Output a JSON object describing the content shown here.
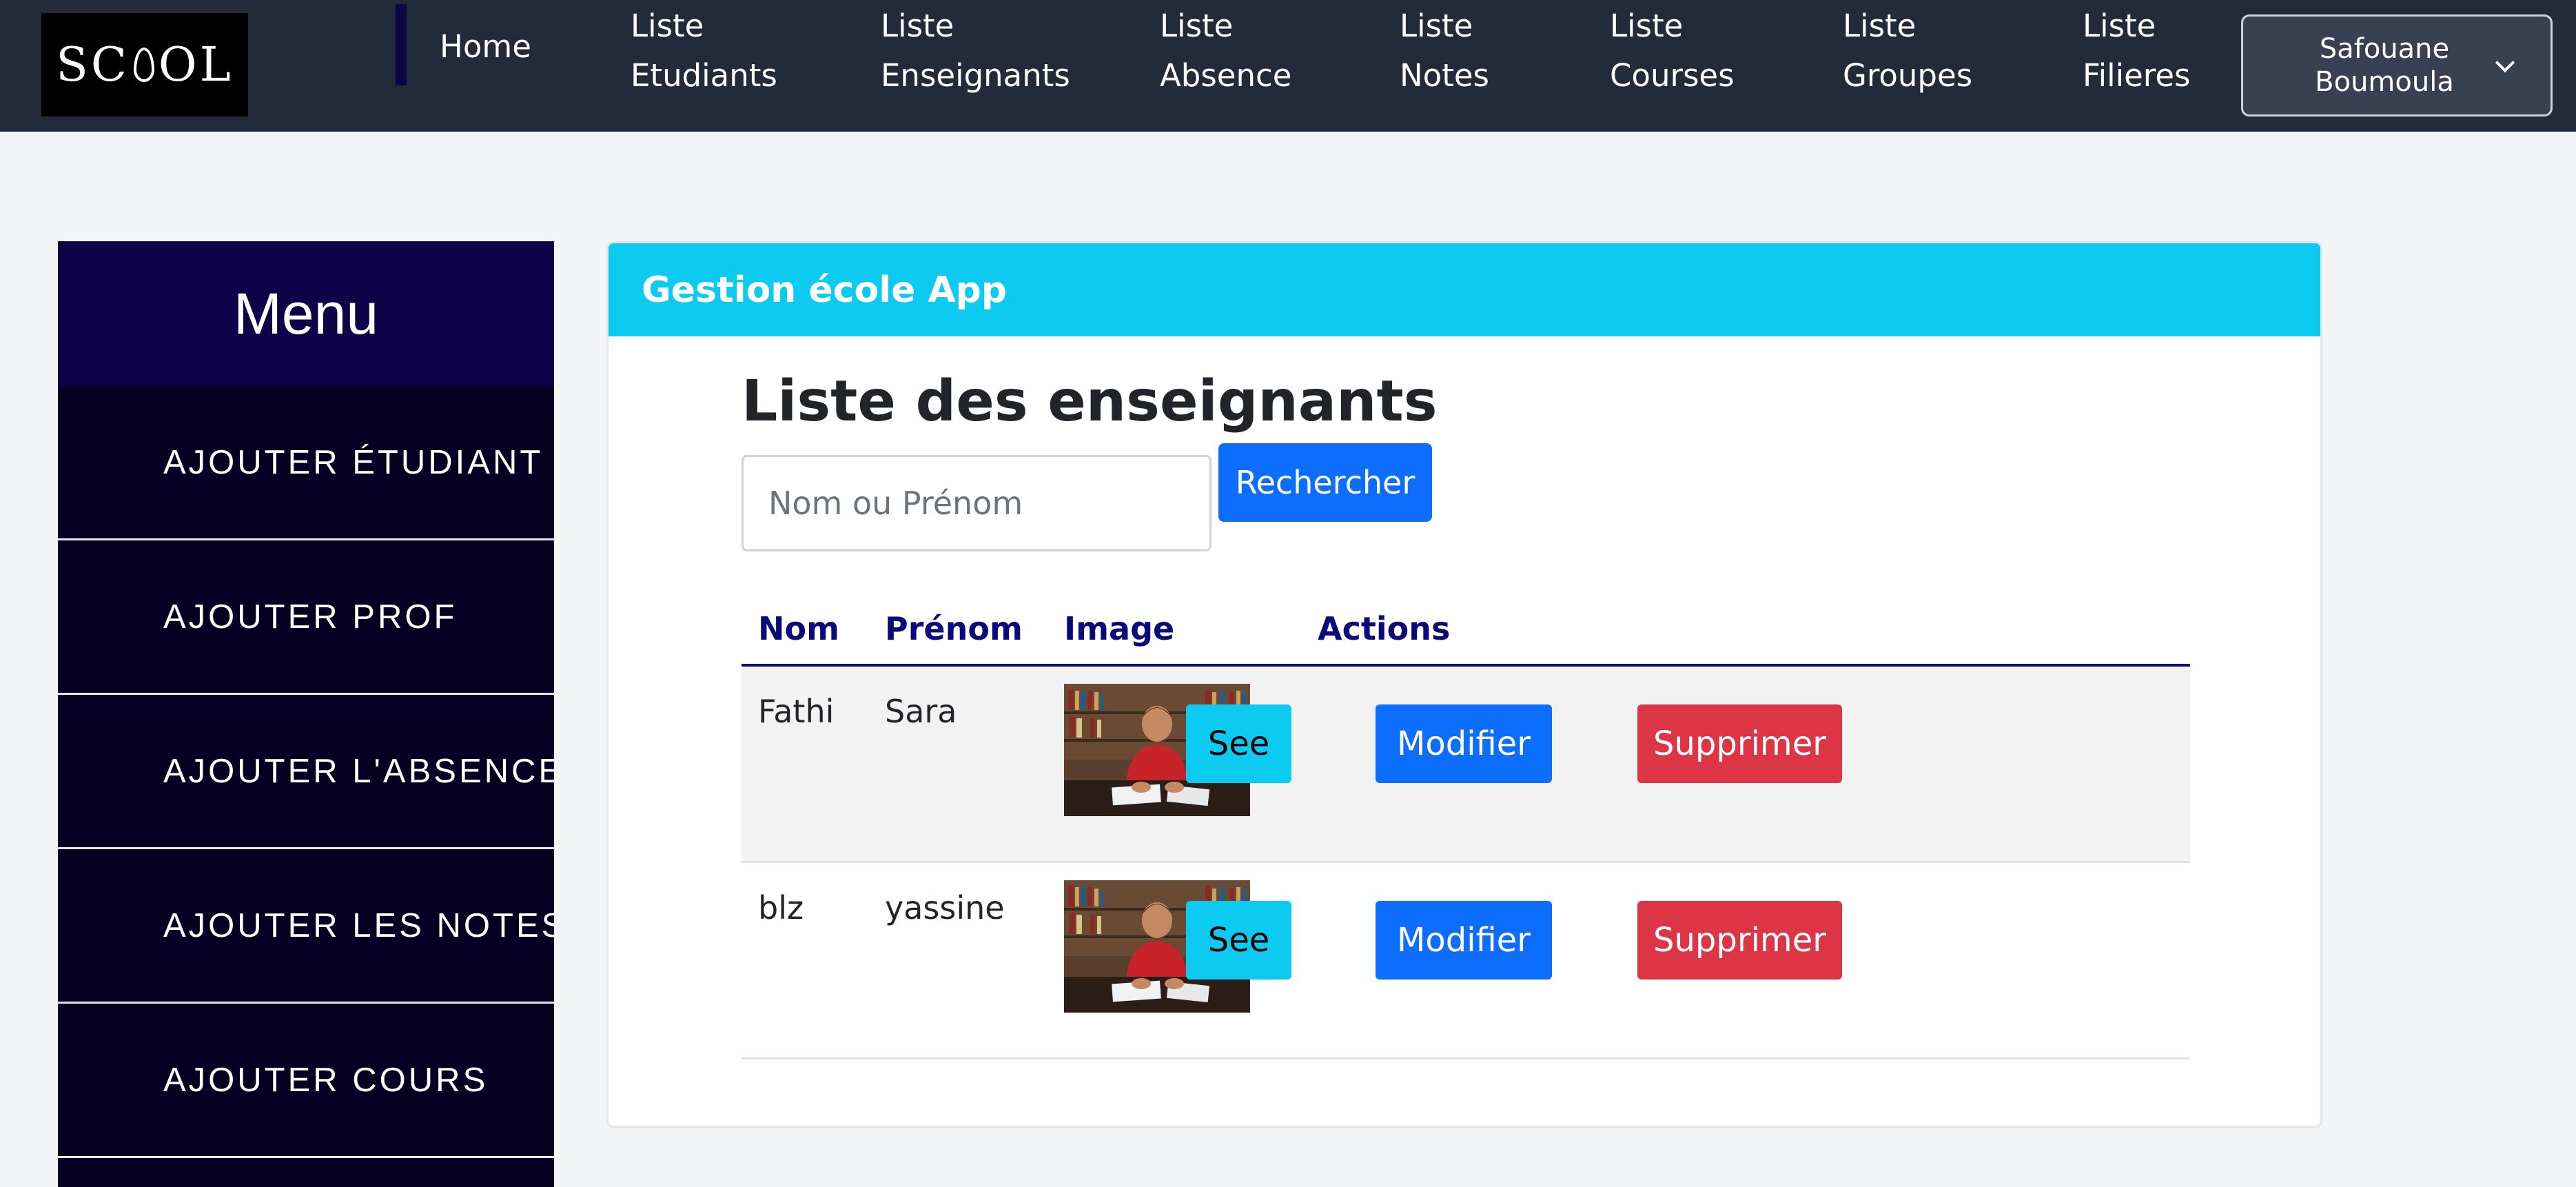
{
  "navbar": {
    "logo_text_left": "SC",
    "logo_text_right": "OL",
    "links": [
      {
        "line1": "Home",
        "line2": ""
      },
      {
        "line1": "Liste",
        "line2": "Etudiants"
      },
      {
        "line1": "Liste",
        "line2": "Enseignants"
      },
      {
        "line1": "Liste",
        "line2": "Absence"
      },
      {
        "line1": "Liste",
        "line2": "Notes"
      },
      {
        "line1": "Liste",
        "line2": "Courses"
      },
      {
        "line1": "Liste",
        "line2": "Groupes"
      },
      {
        "line1": "Liste",
        "line2": "Filieres"
      }
    ],
    "user": {
      "first": "Safouane",
      "last": "Boumoula"
    }
  },
  "sidebar": {
    "title": "Menu",
    "items": [
      {
        "label": "Ajouter Étudiant"
      },
      {
        "label": "Ajouter Prof"
      },
      {
        "label": "Ajouter L'absence"
      },
      {
        "label": "Ajouter les notes"
      },
      {
        "label": "Ajouter Cours"
      }
    ]
  },
  "card": {
    "header": "Gestion école App",
    "title": "Liste des enseignants",
    "search": {
      "placeholder": "Nom ou Prénom",
      "value": "",
      "button": "Rechercher"
    }
  },
  "table": {
    "headers": {
      "nom": "Nom",
      "prenom": "Prénom",
      "image": "Image",
      "actions": "Actions"
    },
    "rows": [
      {
        "nom": "Fathi",
        "prenom": "Sara",
        "see": "See",
        "edit": "Modifier",
        "delete": "Supprimer"
      },
      {
        "nom": "blz",
        "prenom": "yassine",
        "see": "See",
        "edit": "Modifier",
        "delete": "Supprimer"
      }
    ]
  },
  "colors": {
    "navbar": "#222b3a",
    "sidebar": "#050022",
    "sidebar_header": "#0e0348",
    "card_header": "#0dcaf0",
    "primary": "#0d6efd",
    "info": "#0dcaf0",
    "danger": "#dc3545",
    "table_header_text": "#0a0a7a"
  }
}
